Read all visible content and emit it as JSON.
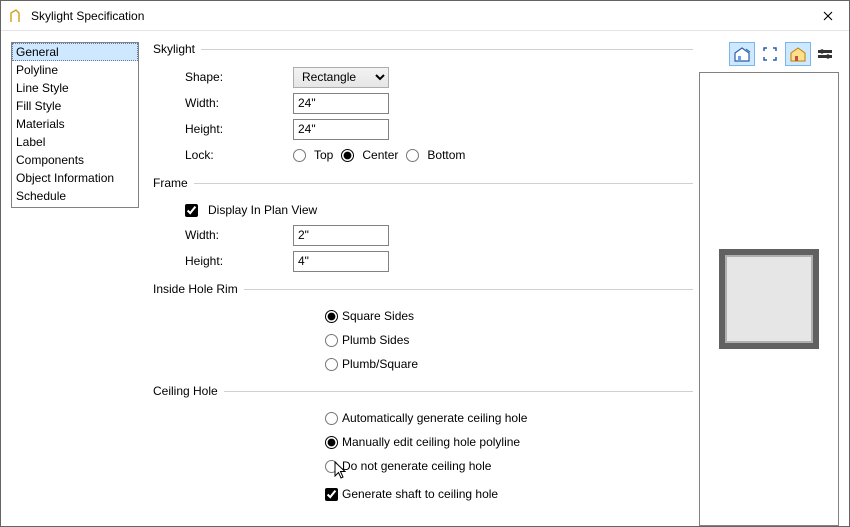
{
  "window": {
    "title": "Skylight Specification"
  },
  "sidebar": {
    "items": [
      {
        "label": "General"
      },
      {
        "label": "Polyline"
      },
      {
        "label": "Line Style"
      },
      {
        "label": "Fill Style"
      },
      {
        "label": "Materials"
      },
      {
        "label": "Label"
      },
      {
        "label": "Components"
      },
      {
        "label": "Object Information"
      },
      {
        "label": "Schedule"
      }
    ],
    "selected": 0
  },
  "groups": {
    "skylight": {
      "legend": "Skylight",
      "shape_label": "Shape:",
      "shape_value": "Rectangle",
      "width_label": "Width:",
      "width_value": "24\"",
      "height_label": "Height:",
      "height_value": "24\"",
      "lock_label": "Lock:",
      "lock_options": {
        "top": "Top",
        "center": "Center",
        "bottom": "Bottom"
      },
      "lock_selected": "center"
    },
    "frame": {
      "legend": "Frame",
      "display_plan_label": "Display In Plan View",
      "display_plan_checked": true,
      "width_label": "Width:",
      "width_value": "2\"",
      "height_label": "Height:",
      "height_value": "4\""
    },
    "inside_hole_rim": {
      "legend": "Inside Hole Rim",
      "options": {
        "square": "Square Sides",
        "plumb": "Plumb Sides",
        "plumb_square": "Plumb/Square"
      },
      "selected": "square"
    },
    "ceiling_hole": {
      "legend": "Ceiling Hole",
      "options": {
        "auto": "Automatically generate ceiling hole",
        "manual": "Manually edit ceiling hole polyline",
        "none": "Do not generate ceiling hole"
      },
      "selected": "manual",
      "shaft_label": "Generate shaft to ceiling hole",
      "shaft_checked": true
    }
  },
  "preview": {
    "tool_icons": [
      "house-plan-icon",
      "fullscreen-icon",
      "house-color-icon",
      "settings-icon"
    ],
    "active_tool": 0
  }
}
